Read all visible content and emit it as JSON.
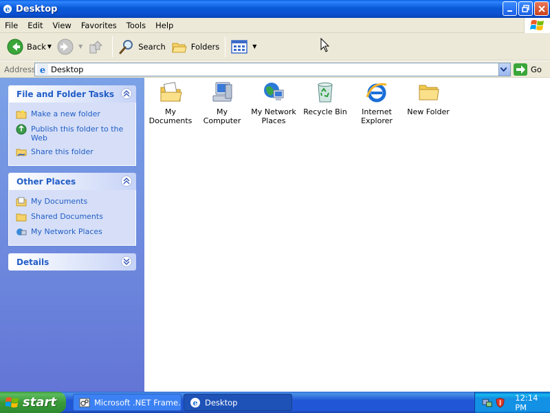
{
  "window": {
    "title": "Desktop"
  },
  "menu": {
    "items": [
      "File",
      "Edit",
      "View",
      "Favorites",
      "Tools",
      "Help"
    ]
  },
  "toolbar": {
    "back_label": "Back",
    "search_label": "Search",
    "folders_label": "Folders"
  },
  "address": {
    "label": "Address",
    "value": "Desktop",
    "go_label": "Go"
  },
  "taskpane": {
    "file_tasks": {
      "title": "File and Folder Tasks",
      "links": [
        "Make a new folder",
        "Publish this folder to the Web",
        "Share this folder"
      ]
    },
    "other_places": {
      "title": "Other Places",
      "links": [
        "My Documents",
        "Shared Documents",
        "My Network Places"
      ]
    },
    "details": {
      "title": "Details"
    }
  },
  "desktop_items": [
    {
      "label": "My Documents",
      "icon": "my-documents-icon"
    },
    {
      "label": "My Computer",
      "icon": "my-computer-icon"
    },
    {
      "label": "My Network Places",
      "icon": "network-places-icon"
    },
    {
      "label": "Recycle Bin",
      "icon": "recycle-bin-icon"
    },
    {
      "label": "Internet Explorer",
      "icon": "internet-explorer-icon"
    },
    {
      "label": "New Folder",
      "icon": "folder-icon"
    }
  ],
  "taskbar": {
    "start_label": "start",
    "tasks": [
      {
        "label": "Microsoft .NET Frame...",
        "active": false
      },
      {
        "label": "Desktop",
        "active": true
      }
    ],
    "clock": "12:14 PM"
  },
  "colors": {
    "titlebar_blue": "#0a5ad8",
    "taskpane_link": "#215dc6",
    "start_green": "#3a9a3a"
  }
}
